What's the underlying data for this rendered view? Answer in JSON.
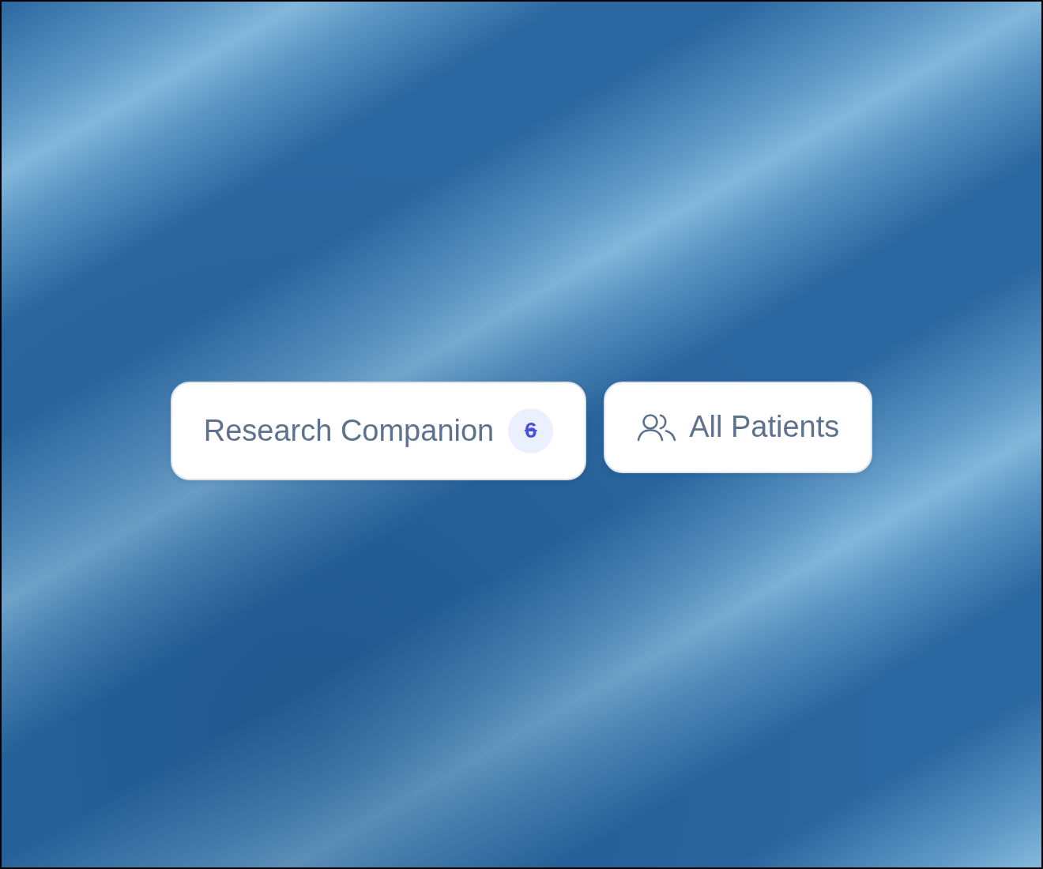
{
  "chips": [
    {
      "kind": "count",
      "label": "Research Companion",
      "badge": {
        "text": "6",
        "struck": true
      }
    },
    {
      "kind": "icon",
      "label": "All Patients"
    }
  ]
}
